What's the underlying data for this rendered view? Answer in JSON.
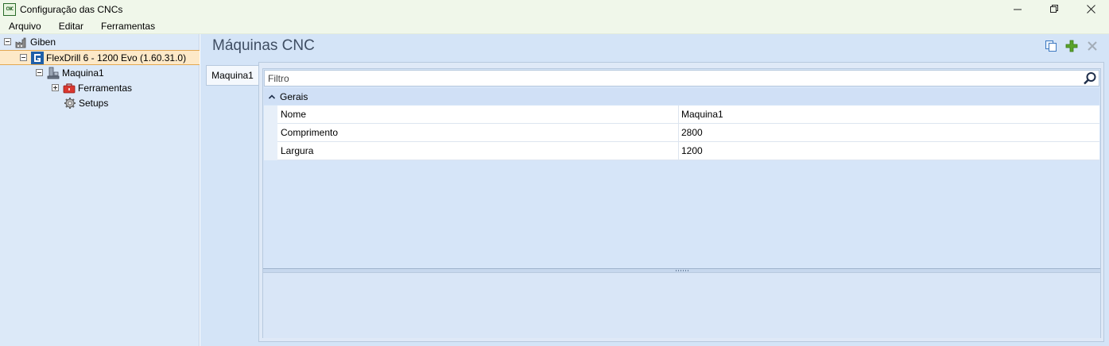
{
  "window": {
    "title": "Configuração das CNCs",
    "icon_label": "CNC",
    "controls": {
      "minimize": "—",
      "maximize": "❐",
      "close": "✕"
    }
  },
  "menu": {
    "items": [
      {
        "label": "Arquivo"
      },
      {
        "label": "Editar"
      },
      {
        "label": "Ferramentas"
      }
    ]
  },
  "tree": {
    "root": {
      "label": "Giben",
      "icon": "factory-icon"
    },
    "machine_model": {
      "label": "FlexDrill 6 - 1200 Evo (1.60.31.0)",
      "icon": "giben-logo-icon"
    },
    "machine": {
      "label": "Maquina1",
      "icon": "machine-icon"
    },
    "tools": {
      "label": "Ferramentas",
      "icon": "toolbox-icon"
    },
    "setups": {
      "label": "Setups",
      "icon": "gear-icon"
    }
  },
  "content": {
    "title": "Máquinas CNC",
    "tab_label": "Maquina1",
    "filter_placeholder": "Filtro",
    "category": "Gerais",
    "properties": [
      {
        "name": "Nome",
        "value": "Maquina1"
      },
      {
        "name": "Comprimento",
        "value": "2800"
      },
      {
        "name": "Largura",
        "value": "1200"
      }
    ]
  },
  "colors": {
    "accent_green": "#5aa32a",
    "selection_fill": "#fde9c8",
    "selection_border": "#e3a851",
    "panel_blue": "#d4e4f7"
  }
}
